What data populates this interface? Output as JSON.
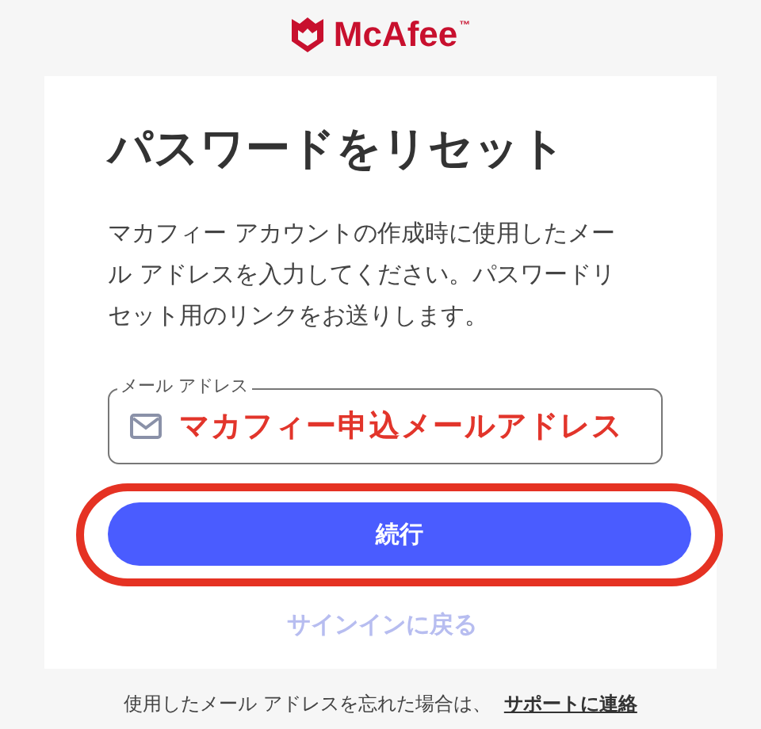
{
  "logo": {
    "name": "McAfee",
    "trademark": "™"
  },
  "card": {
    "title": "パスワードをリセット",
    "description": "マカフィー アカウントの作成時に使用したメール アドレスを入力してください。パスワードリセット用のリンクをお送りします。",
    "email_field": {
      "label": "メール アドレス",
      "value": "マカフィー申込メールアドレス"
    },
    "continue_button": {
      "label": "続行",
      "highlighted": true
    },
    "signin_link": "サインインに戻る"
  },
  "footer": {
    "text": "使用したメール アドレスを忘れた場合は、",
    "link": "サポートに連絡"
  }
}
